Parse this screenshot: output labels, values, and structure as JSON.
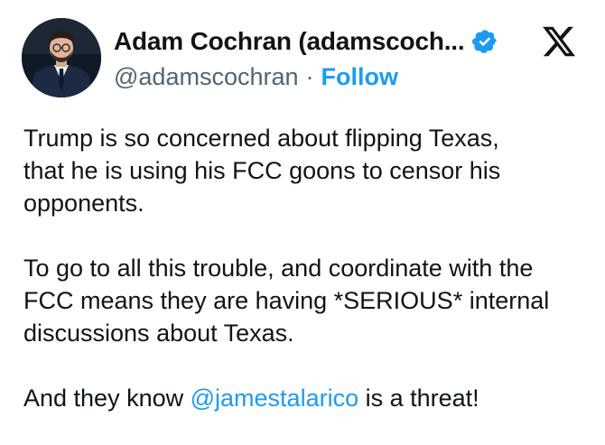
{
  "author": {
    "display_name": "Adam Cochran (adamscoch...",
    "handle": "@adamscochran",
    "separator": "·",
    "follow_label": "Follow",
    "verified": true,
    "avatar_icon": "profile-photo",
    "platform_icon": "x-logo-icon"
  },
  "tweet": {
    "paragraph_1": {
      "lines": [
        "Trump is so concerned about flipping Texas,",
        "that he is using his FCC goons to censor his",
        "opponents."
      ]
    },
    "paragraph_2": {
      "lines": [
        "To go to all this trouble, and coordinate with the",
        "FCC means they are having *SERIOUS* internal",
        "discussions about Texas."
      ]
    },
    "paragraph_3": {
      "prefix": "And they know ",
      "mention": "@jamestalarico",
      "suffix": " is a threat!"
    }
  },
  "colors": {
    "text": "#0f1419",
    "secondary": "#536471",
    "link": "#1d9bf0",
    "verified_badge": "#1d9bf0"
  }
}
